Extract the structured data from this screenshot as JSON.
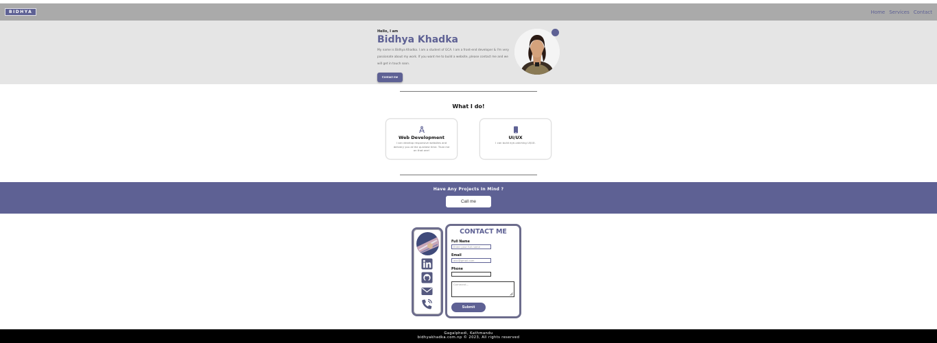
{
  "nav": {
    "logo": "BIDHYA",
    "links": [
      "Home",
      "Services",
      "Contact"
    ]
  },
  "hero": {
    "greeting": "Hello, I am",
    "name": "Bidhya Khadka",
    "description": "My name is Bidhya Khadka. I am a student of GCA. I am a front-end developer & I'm very passionate about my work. If you want me to build a website, please contact me and we will get in touch soon.",
    "button": "Contact me"
  },
  "services": {
    "title": "What I do!",
    "cards": [
      {
        "title": "Web Development",
        "description": "I can develop responsive websites and delivery you at the quickest time. Trust me on that one!",
        "icon": "compass-icon"
      },
      {
        "title": "UI/UX",
        "description": "I can build eye-catching UI/UX.",
        "icon": "phone-icon"
      }
    ]
  },
  "cta": {
    "title": "Have Any Projects In Mind ?",
    "button": "Call me"
  },
  "contact": {
    "title": "CONTACT ME",
    "fields": {
      "full_name_label": "Full Name",
      "full_name_placeholder": "Enter your full name",
      "email_label": "Email",
      "email_placeholder": "abc@gmail.com",
      "phone_label": "Phone",
      "phone_placeholder": "",
      "comment_placeholder": "Comment..."
    },
    "submit": "Submit",
    "social_icons": [
      "linkedin-icon",
      "github-icon",
      "mail-icon",
      "phone-call-icon"
    ]
  },
  "footer": {
    "line1": "Gagalphedi, Kathmandu",
    "line2": "bidhyakhadka.com.np © 2023, All rights reserved"
  },
  "colors": {
    "accent": "#5e6194",
    "nav_bg": "#aaaaaa",
    "hero_bg": "#e5e5e5",
    "footer_bg": "#000000"
  }
}
